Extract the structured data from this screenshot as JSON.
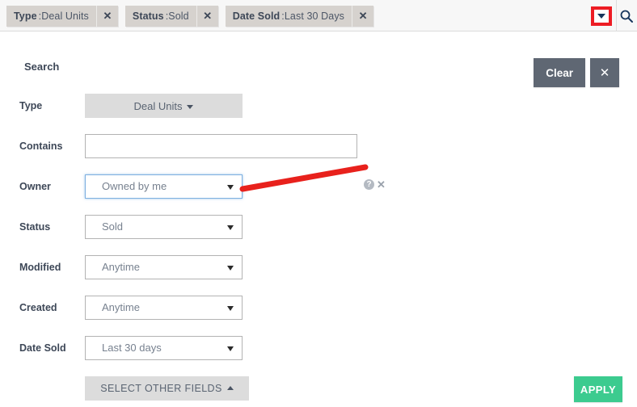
{
  "topbar": {
    "chips": [
      {
        "field": "Type",
        "separator": ": ",
        "value": "Deal Units",
        "remove_label": "✕"
      },
      {
        "field": "Status",
        "separator": ": ",
        "value": "Sold",
        "remove_label": "✕"
      },
      {
        "field": "Date Sold",
        "separator": ": ",
        "value": "Last 30 Days",
        "remove_label": "✕"
      }
    ],
    "dropdown_toggle_icon": "chevron-down-icon",
    "search_icon": "search-icon",
    "highlight_color": "#ed1c24"
  },
  "panel": {
    "title": "Search",
    "clear_label": "Clear",
    "close_label": "✕",
    "apply_label": "APPLY",
    "apply_color": "#3ccb8f",
    "select_other_fields_label": "SELECT OTHER FIELDS",
    "select_other_fields_caret": "caret-up-icon"
  },
  "form": {
    "rows": [
      {
        "label": "Type",
        "kind": "button",
        "value": "Deal Units"
      },
      {
        "label": "Contains",
        "kind": "text",
        "value": "",
        "placeholder": ""
      },
      {
        "label": "Owner",
        "kind": "select",
        "value": "Owned by me",
        "focused": true,
        "help_icon": "help-circle-icon",
        "clear_icon": "clear-x-icon"
      },
      {
        "label": "Status",
        "kind": "select",
        "value": "Sold"
      },
      {
        "label": "Modified",
        "kind": "select",
        "value": "Anytime"
      },
      {
        "label": "Created",
        "kind": "select",
        "value": "Anytime"
      },
      {
        "label": "Date Sold",
        "kind": "select",
        "value": "Last 30 days"
      }
    ]
  },
  "annotation": {
    "type": "red-arrow-line",
    "color": "#e8211c",
    "points_to": "owner-select"
  }
}
